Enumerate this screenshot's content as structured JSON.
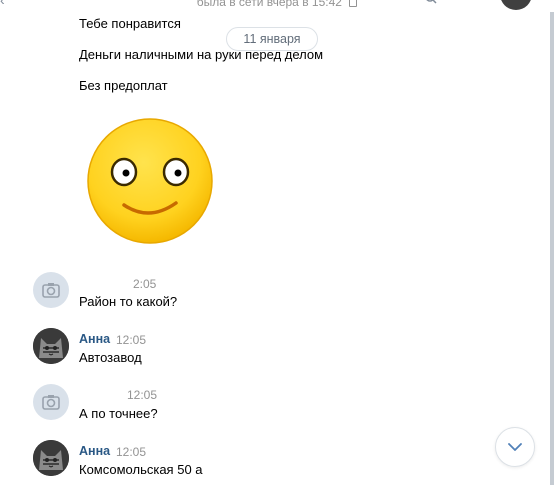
{
  "header": {
    "status": "была в сети вчера в 15:42"
  },
  "date_separator": "11 января",
  "lines": [
    "Тебе понравится",
    "Деньги наличными на руки перед делом",
    "Без предоплат"
  ],
  "messages": [
    {
      "author": "",
      "time": "2:05",
      "text": "Район то какой?",
      "avatar": "camera-icon"
    },
    {
      "author": "Анна",
      "time": "12:05",
      "text": "Автозавод",
      "avatar": "cat-avatar"
    },
    {
      "author": "",
      "time": "12:05",
      "text": "А по точнее?",
      "avatar": "camera-icon"
    },
    {
      "author": "Анна",
      "time": "12:05",
      "text": "Комсомольская 50 а",
      "avatar": "cat-avatar"
    }
  ],
  "colors": {
    "author": "#2a5885",
    "muted": "#939393",
    "smiley_yellow": "#ffd21f"
  }
}
